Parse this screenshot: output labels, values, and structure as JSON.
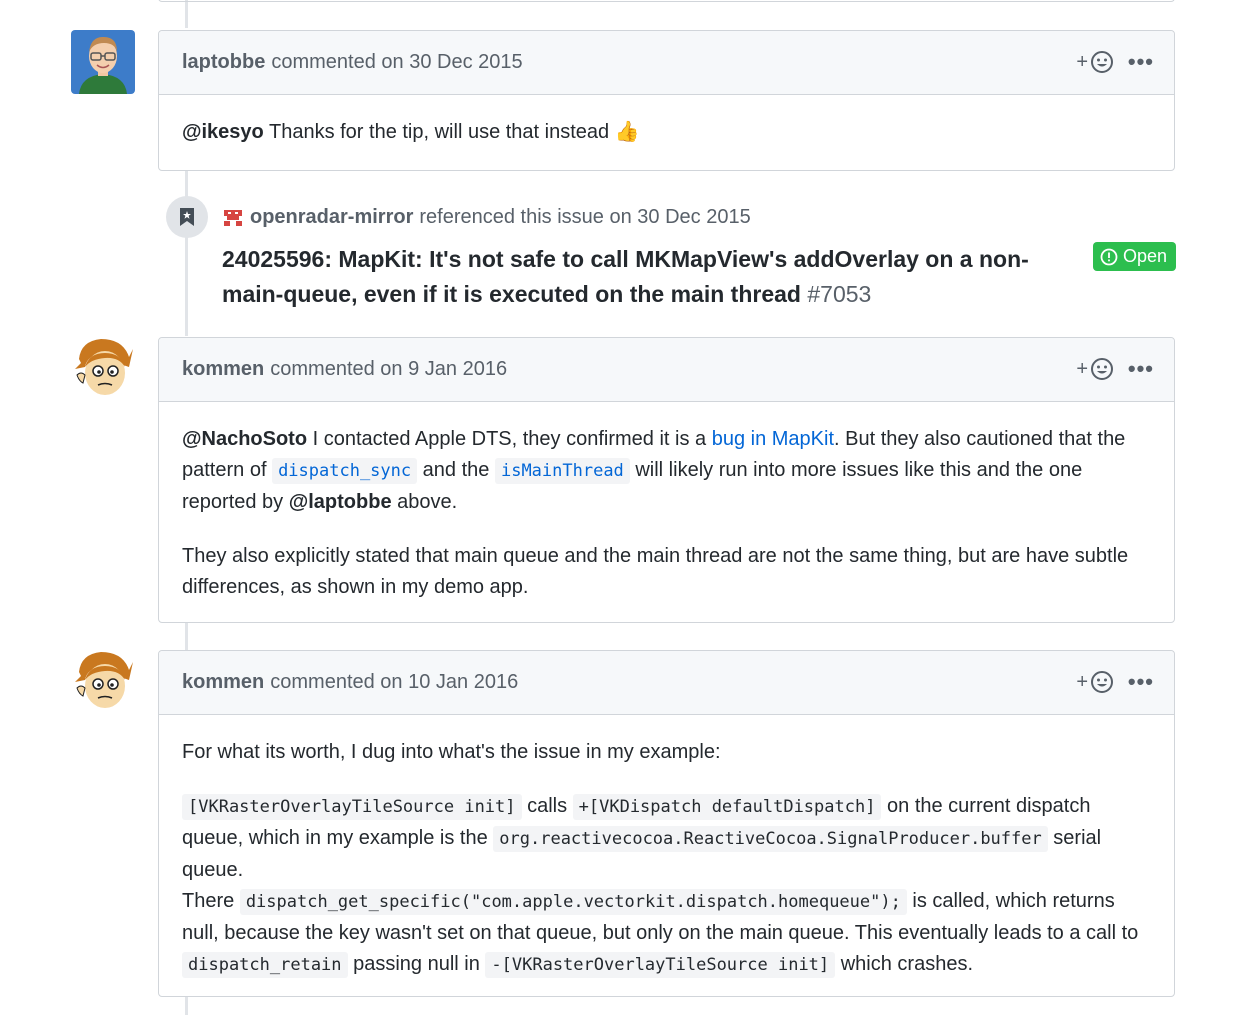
{
  "comments": [
    {
      "author": "laptobbe",
      "meta": "commented on 30 Dec 2015",
      "body": {
        "mention": "@ikesyo",
        "text": " Thanks for the tip, will use that instead ",
        "emoji": "👍"
      }
    },
    {
      "author": "kommen",
      "meta": "commented on 9 Jan 2016",
      "p1": {
        "mention": "@NachoSoto",
        "t1": " I contacted Apple DTS, they confirmed it is a ",
        "link": "bug in MapKit",
        "t2": ". But they also cautioned that the pattern of ",
        "code1": "dispatch_sync",
        "t3": " and the ",
        "code2": "isMainThread",
        "t4": " will likely run into more issues like this and the one reported by ",
        "mention2": "@laptobbe",
        "t5": " above."
      },
      "p2": "They also explicitly stated that main queue and the main thread are not the same thing, but are have subtle differences, as shown in my demo app."
    },
    {
      "author": "kommen",
      "meta": "commented on 10 Jan 2016",
      "p1": "For what its worth, I dug into what's the issue in my example:",
      "p2": {
        "code1": "[VKRasterOverlayTileSource init]",
        "t1": " calls ",
        "code2": "+[VKDispatch defaultDispatch]",
        "t2": " on the current dispatch queue, which in my example is the ",
        "code3": "org.reactivecocoa.ReactiveCocoa.SignalProducer.buffer",
        "t3": " serial queue.",
        "t4": "There ",
        "code4": "dispatch_get_specific(\"com.apple.vectorkit.dispatch.homequeue\");",
        "t5": " is called, which returns null, because the key wasn't set on that queue, but only on the main queue. This eventually leads to a call to ",
        "code5": "dispatch_retain",
        "t6": " passing null in ",
        "code6": "-[VKRasterOverlayTileSource init]",
        "t7": " which crashes."
      }
    }
  ],
  "reference": {
    "author": "openradar-mirror",
    "meta": "referenced this issue on 30 Dec 2015",
    "title": "24025596: MapKit: It's not safe to call MKMapView's addOverlay on a non-main-queue, even if it is executed on the main thread",
    "number": "#7053",
    "status": "Open"
  },
  "ui": {
    "reaction_plus": "+",
    "more": "•••"
  },
  "colors": {
    "link": "#0366d6",
    "open_green": "#2cbe4e",
    "border": "#d1d5da",
    "header_bg": "#f6f8fa"
  }
}
